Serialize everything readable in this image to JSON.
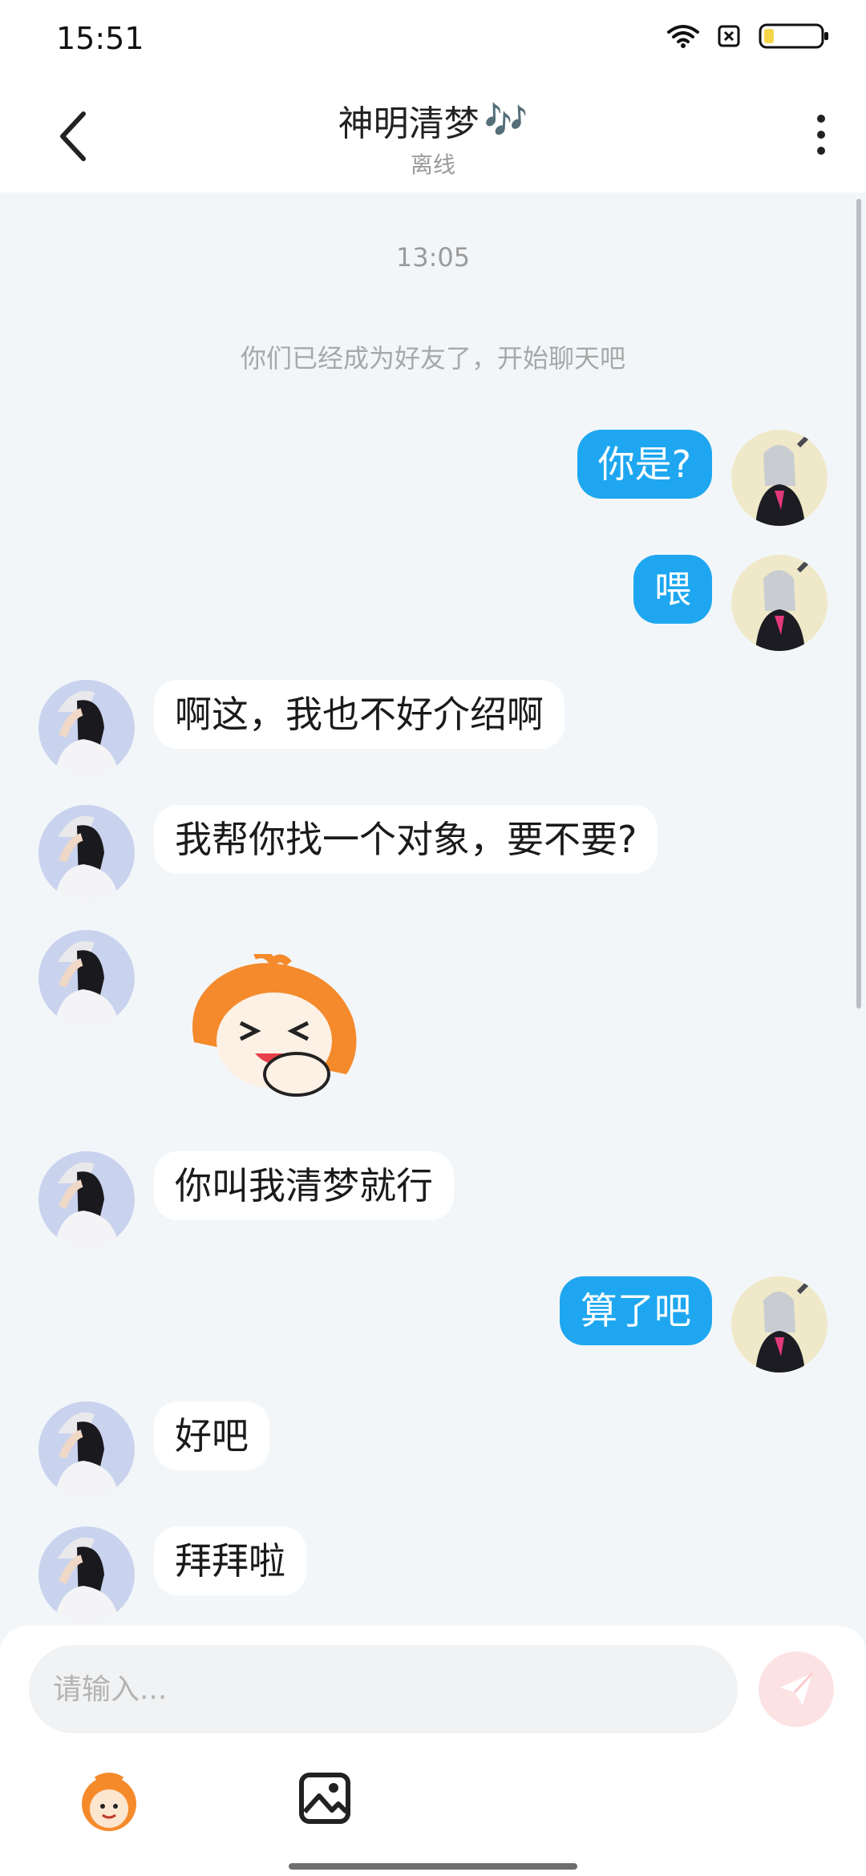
{
  "status_bar": {
    "time": "15:51"
  },
  "header": {
    "title": "神明清梦",
    "title_emoji": "🎶",
    "subtitle": "离线"
  },
  "chat": {
    "time_label": "13:05",
    "system_note": "你们已经成为好友了，开始聊天吧",
    "messages": [
      {
        "side": "me",
        "type": "text",
        "text": "你是?"
      },
      {
        "side": "me",
        "type": "text",
        "text": "喂"
      },
      {
        "side": "them",
        "type": "text",
        "text": "啊这，我也不好介绍啊"
      },
      {
        "side": "them",
        "type": "text",
        "text": "我帮你找一个对象，要不要?"
      },
      {
        "side": "them",
        "type": "sticker",
        "sticker": "laughing-mascot-sticker"
      },
      {
        "side": "them",
        "type": "text",
        "text": "你叫我清梦就行"
      },
      {
        "side": "me",
        "type": "text",
        "text": "算了吧"
      },
      {
        "side": "them",
        "type": "text",
        "text": "好吧"
      },
      {
        "side": "them",
        "type": "text",
        "text": "拜拜啦"
      }
    ]
  },
  "input": {
    "placeholder": "请输入..."
  },
  "icons": {
    "back": "back-arrow-icon",
    "more": "more-vertical-icon",
    "send": "send-plane-icon",
    "emoji": "mascot-emoji-icon",
    "image": "image-icon"
  },
  "colors": {
    "my_bubble": "#1ea7f0",
    "their_bubble": "#ffffff",
    "background": "#f3f6f9",
    "send_button_disabled": "#fde2e3"
  }
}
